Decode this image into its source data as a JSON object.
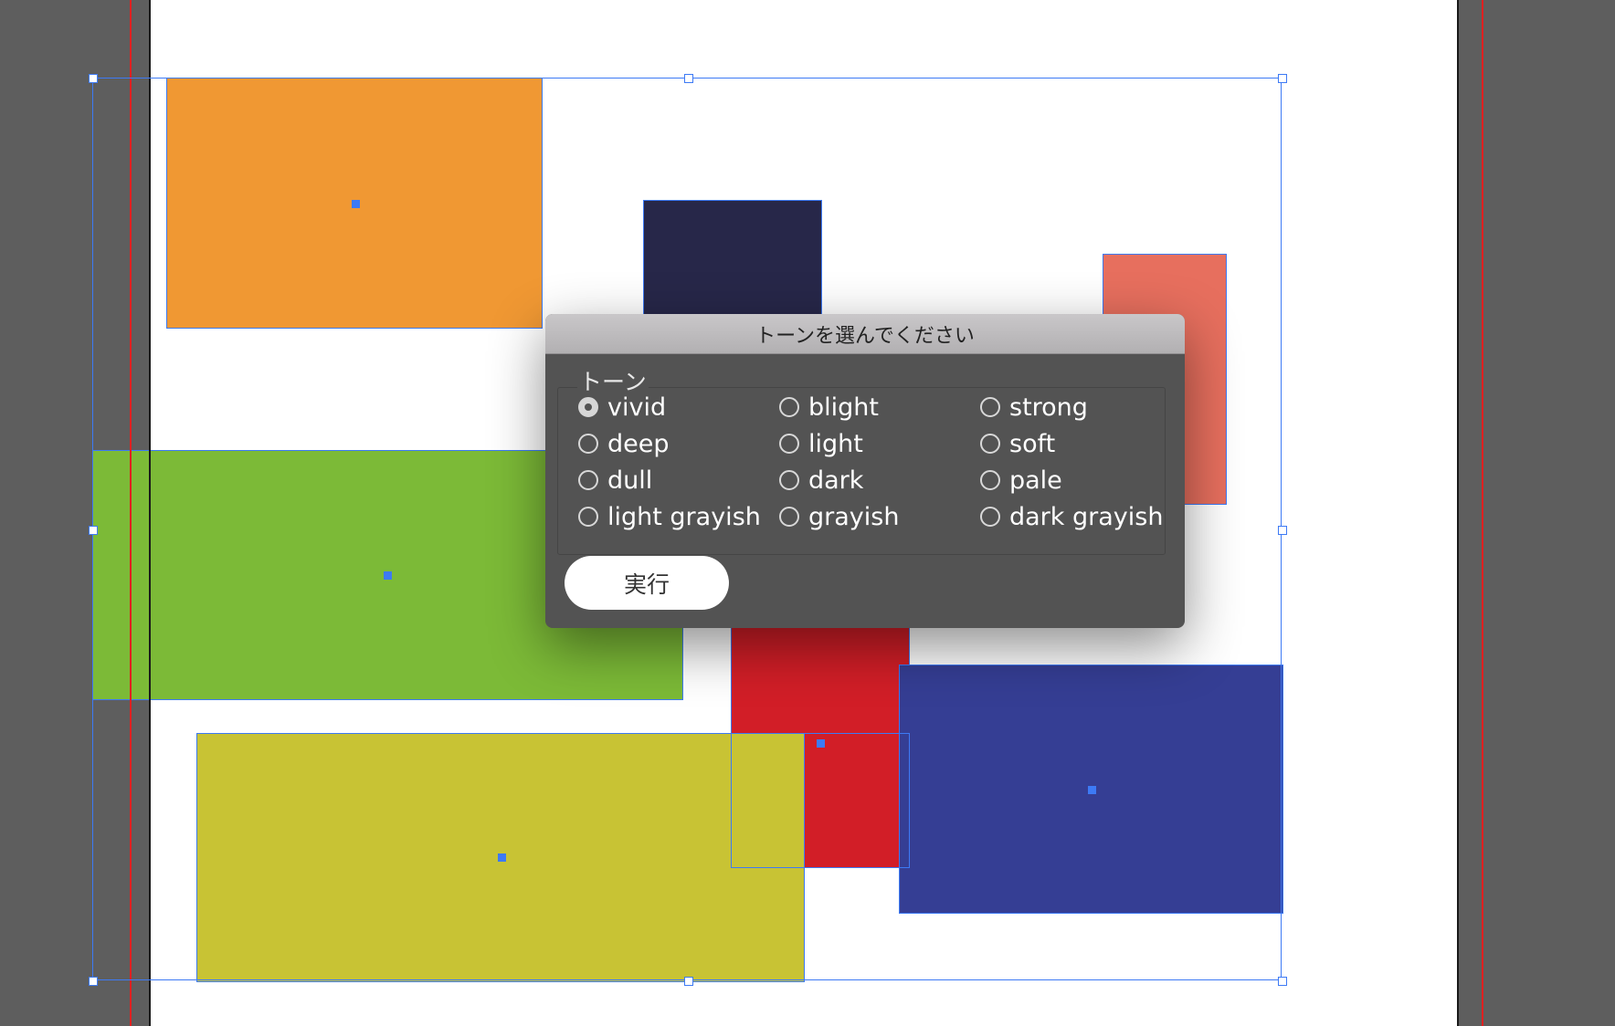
{
  "dialog": {
    "title": "トーンを選んでください",
    "group_label": "トーン",
    "options": [
      {
        "label": "vivid",
        "selected": true
      },
      {
        "label": "blight",
        "selected": false
      },
      {
        "label": "strong",
        "selected": false
      },
      {
        "label": "deep",
        "selected": false
      },
      {
        "label": "light",
        "selected": false
      },
      {
        "label": "soft",
        "selected": false
      },
      {
        "label": "dull",
        "selected": false
      },
      {
        "label": "dark",
        "selected": false
      },
      {
        "label": "pale",
        "selected": false
      },
      {
        "label": "light grayish",
        "selected": false
      },
      {
        "label": "grayish",
        "selected": false
      },
      {
        "label": "dark grayish",
        "selected": false
      }
    ],
    "execute_label": "実行"
  },
  "colors": {
    "selection_accent": "#3d7af5",
    "guide": "#e02020",
    "orange_rect": "#f09833",
    "navy_rect": "#272749",
    "salmon_rect": "#e76f5e",
    "green_rect": "#7cba37",
    "red_rect": "#d21e27",
    "yellow_rect": "#c8c334",
    "blue_rect": "#353e94"
  }
}
